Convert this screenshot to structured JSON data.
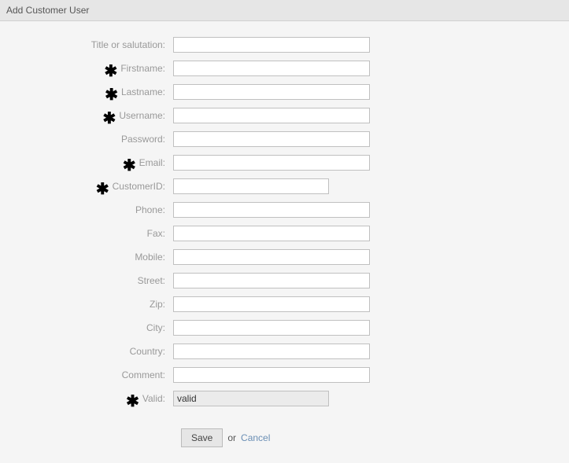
{
  "header": {
    "title": "Add Customer User"
  },
  "required_symbol": "✱",
  "fields": {
    "title": {
      "label": "Title or salutation:",
      "required": false,
      "value": "",
      "short": false
    },
    "firstname": {
      "label": "Firstname:",
      "required": true,
      "value": "",
      "short": false
    },
    "lastname": {
      "label": "Lastname:",
      "required": true,
      "value": "",
      "short": false
    },
    "username": {
      "label": "Username:",
      "required": true,
      "value": "",
      "short": false
    },
    "password": {
      "label": "Password:",
      "required": false,
      "value": "",
      "short": false
    },
    "email": {
      "label": "Email:",
      "required": true,
      "value": "",
      "short": false
    },
    "customerid": {
      "label": "CustomerID:",
      "required": true,
      "value": "",
      "short": true
    },
    "phone": {
      "label": "Phone:",
      "required": false,
      "value": "",
      "short": false
    },
    "fax": {
      "label": "Fax:",
      "required": false,
      "value": "",
      "short": false
    },
    "mobile": {
      "label": "Mobile:",
      "required": false,
      "value": "",
      "short": false
    },
    "street": {
      "label": "Street:",
      "required": false,
      "value": "",
      "short": false
    },
    "zip": {
      "label": "Zip:",
      "required": false,
      "value": "",
      "short": false
    },
    "city": {
      "label": "City:",
      "required": false,
      "value": "",
      "short": false
    },
    "country": {
      "label": "Country:",
      "required": false,
      "value": "",
      "short": false
    },
    "comment": {
      "label": "Comment:",
      "required": false,
      "value": "",
      "short": false
    },
    "valid": {
      "label": "Valid:",
      "required": true,
      "value": "valid",
      "short": true
    }
  },
  "field_order": [
    "title",
    "firstname",
    "lastname",
    "username",
    "password",
    "email",
    "customerid",
    "phone",
    "fax",
    "mobile",
    "street",
    "zip",
    "city",
    "country",
    "comment",
    "valid"
  ],
  "actions": {
    "save": "Save",
    "or": "or",
    "cancel": "Cancel"
  }
}
